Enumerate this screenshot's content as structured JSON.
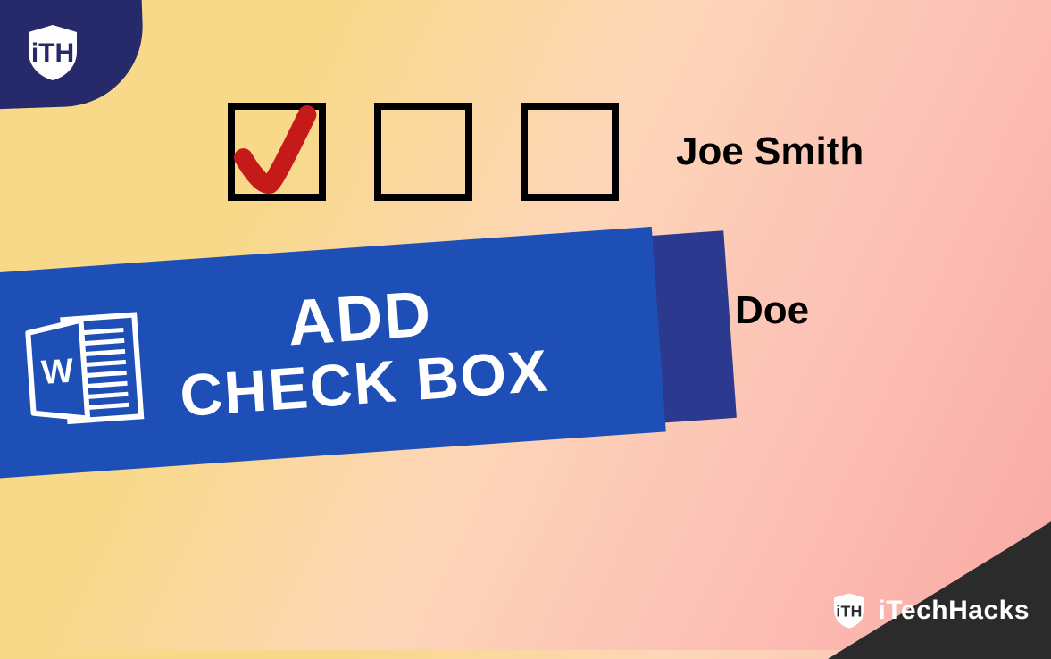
{
  "rows": [
    {
      "name": "Joe Smith"
    },
    {
      "name": "nn Doe"
    }
  ],
  "banner": {
    "line1": "ADD",
    "line2": "CHECK BOX"
  },
  "brand": "iTechHacks",
  "colors": {
    "bannerFront": "#1e4fb7",
    "bannerBack": "#2b3a8f",
    "corner": "#262a6a",
    "check": "#c51a1a"
  }
}
